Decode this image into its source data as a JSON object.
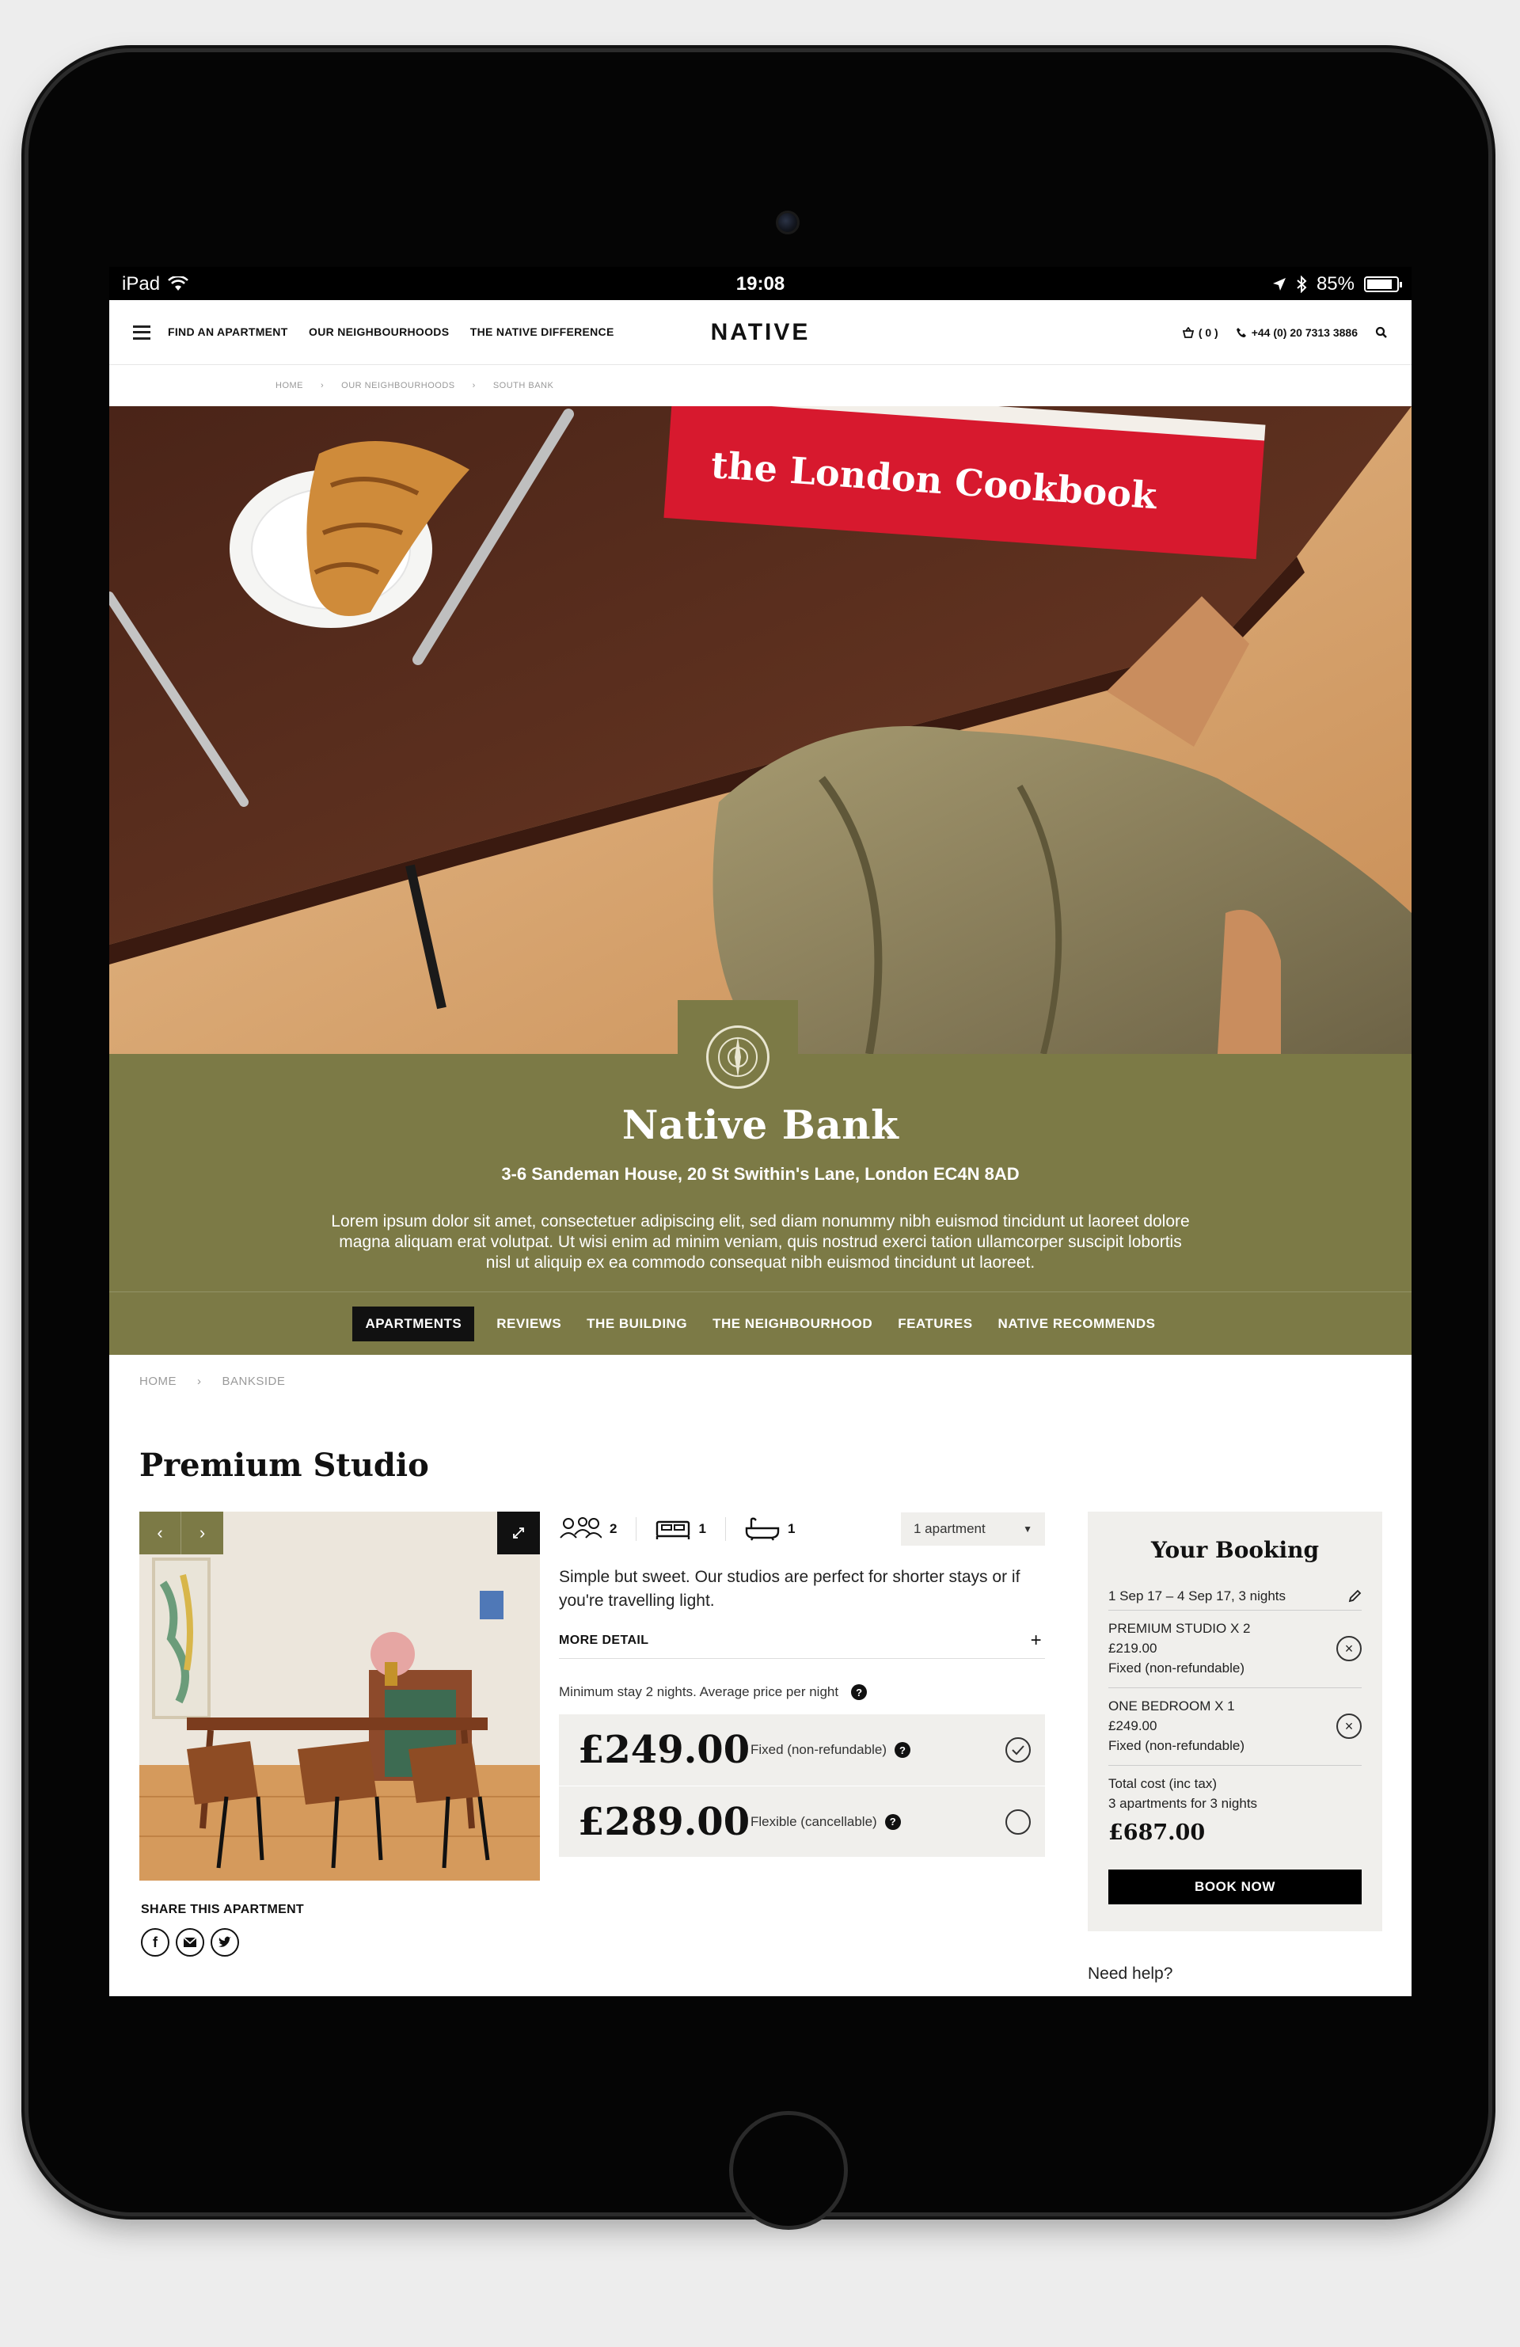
{
  "status_bar": {
    "device": "iPad",
    "time": "19:08",
    "battery": "85%",
    "battery_level": 0.85
  },
  "header": {
    "nav": [
      "FIND AN APARTMENT",
      "OUR NEIGHBOURHOODS",
      "THE NATIVE DIFFERENCE"
    ],
    "logo": "NATIVE",
    "cart": "( 0 )",
    "phone": "+44 (0) 20 7313 3886"
  },
  "breadcrumb_top": [
    "HOME",
    "OUR NEIGHBOURHOODS",
    "SOUTH BANK"
  ],
  "hero": {
    "book_spine": "the London Cookbook"
  },
  "property": {
    "name": "Native Bank",
    "address": "3-6 Sandeman House, 20 St Swithin's Lane, London EC4N 8AD",
    "description": "Lorem ipsum dolor sit amet, consectetuer adipiscing elit, sed diam nonummy nibh euismod tincidunt ut laoreet dolore magna aliquam erat volutpat. Ut wisi enim ad minim veniam, quis nostrud exerci tation ullamcorper suscipit lobortis nisl ut aliquip ex ea commodo consequat nibh euismod tincidunt ut laoreet."
  },
  "tabs": [
    "APARTMENTS",
    "REVIEWS",
    "THE BUILDING",
    "THE NEIGHBOURHOOD",
    "FEATURES",
    "NATIVE RECOMMENDS"
  ],
  "breadcrumb_content": [
    "HOME",
    "BANKSIDE"
  ],
  "apartment": {
    "title": "Premium Studio",
    "guests": "2",
    "beds": "1",
    "baths": "1",
    "select": "1 apartment",
    "summary": "Simple but sweet. Our studios are perfect for shorter stays or if you're travelling light.",
    "more_detail": "MORE DETAIL",
    "min_stay": "Minimum stay 2 nights. Average price per night",
    "prices": [
      {
        "amount": "£249.00",
        "label": "Fixed (non-refundable)",
        "selected": true
      },
      {
        "amount": "£289.00",
        "label": "Flexible (cancellable)",
        "selected": false
      }
    ],
    "share_label": "SHARE THIS APARTMENT"
  },
  "booking": {
    "title": "Your Booking",
    "dates": "1 Sep 17 – 4 Sep 17, 3 nights",
    "items": [
      {
        "title": "PREMIUM STUDIO X 2",
        "price": "£219.00",
        "rate": "Fixed (non-refundable)"
      },
      {
        "title": "ONE BEDROOM X 1",
        "price": "£249.00",
        "rate": "Fixed (non-refundable)"
      }
    ],
    "total_label": "Total cost (inc tax)",
    "total_sub": "3 apartments for 3 nights",
    "total": "£687.00",
    "book_now": "BOOK NOW"
  },
  "help": "Need help?"
}
